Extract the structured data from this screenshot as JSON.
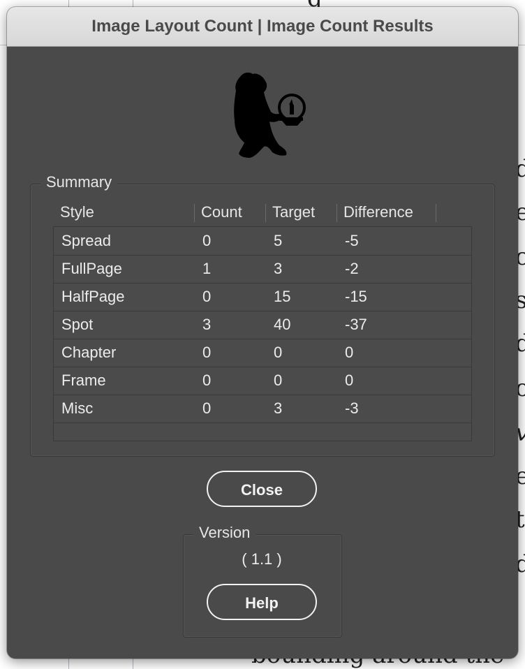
{
  "window": {
    "title": "Image Layout Count | Image Count Results"
  },
  "summary": {
    "label": "Summary",
    "columns": [
      "Style",
      "Count",
      "Target",
      "Difference"
    ],
    "rows": [
      {
        "style": "Spread",
        "count": "0",
        "target": "5",
        "difference": "-5"
      },
      {
        "style": "FullPage",
        "count": "1",
        "target": "3",
        "difference": "-2"
      },
      {
        "style": "HalfPage",
        "count": "0",
        "target": "15",
        "difference": "-15"
      },
      {
        "style": "Spot",
        "count": "3",
        "target": "40",
        "difference": "-37"
      },
      {
        "style": "Chapter",
        "count": "0",
        "target": "0",
        "difference": "0"
      },
      {
        "style": "Frame",
        "count": "0",
        "target": "0",
        "difference": "0"
      },
      {
        "style": "Misc",
        "count": "0",
        "target": "3",
        "difference": "-3"
      }
    ]
  },
  "buttons": {
    "close_label": "Close",
    "help_label": "Help"
  },
  "version": {
    "label": "Version",
    "value": "( 1.1 )"
  },
  "background_document": {
    "top_text": "g",
    "right_letters": [
      "d",
      "e",
      "c",
      "s",
      "d",
      "o",
      "v",
      "e",
      "t",
      "d"
    ],
    "bottom_text": "bounding around the"
  },
  "colors": {
    "dialog_bg": "#4a4a4a",
    "titlebar_bg": "#dcdcdc",
    "text": "#ececec"
  },
  "icons": {
    "logo": "bear-with-candle-icon"
  }
}
